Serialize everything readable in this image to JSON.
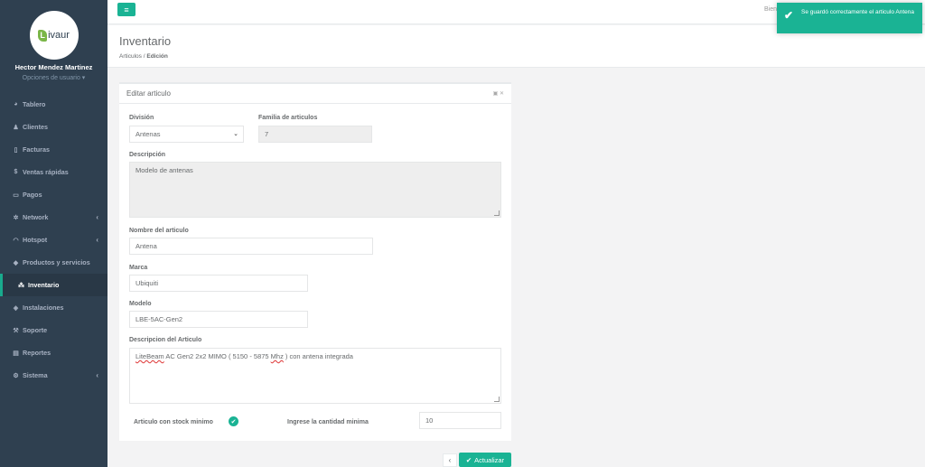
{
  "sidebar": {
    "logo_letter": "L",
    "logo_text": "ivaur",
    "user_name": "Hector Mendez Martinez",
    "user_options": "Opciones de usuario ▾",
    "items": [
      {
        "label": "Tablero",
        "icon": "dashboard-icon"
      },
      {
        "label": "Clientes",
        "icon": "users-icon"
      },
      {
        "label": "Facturas",
        "icon": "file-icon"
      },
      {
        "label": "Ventas rápidas",
        "icon": "dollar-icon"
      },
      {
        "label": "Pagos",
        "icon": "money-icon"
      },
      {
        "label": "Network",
        "icon": "network-icon"
      },
      {
        "label": "Hotspot",
        "icon": "wifi-icon"
      },
      {
        "label": "Productos y servicios",
        "icon": "tag-icon"
      },
      {
        "label": "Inventario",
        "icon": "cubes-icon"
      },
      {
        "label": "Instalaciones",
        "icon": "wrench-icon"
      },
      {
        "label": "Soporte",
        "icon": "support-icon"
      },
      {
        "label": "Reportes",
        "icon": "book-icon"
      },
      {
        "label": "Sistema",
        "icon": "cogs-icon"
      }
    ]
  },
  "topbar": {
    "welcome": "Bien"
  },
  "heading": {
    "title": "Inventario",
    "crumb_1": "Articulos",
    "crumb_sep": "/",
    "crumb_2": "Edición"
  },
  "panel": {
    "title": "Editar articulo",
    "division_label": "División",
    "division_value": "Antenas",
    "familia_label": "Familia de articulos",
    "familia_value": "7",
    "descripcion_label": "Descripción",
    "descripcion_value": "Modelo de antenas",
    "nombre_label": "Nombre del articulo",
    "nombre_value": "Antena",
    "marca_label": "Marca",
    "marca_value": "Ubiquiti",
    "modelo_label": "Modelo",
    "modelo_value": "LBE-5AC-Gen2",
    "desc_articulo_label": "Descripcion del Articulo",
    "desc_articulo_p1": "LiteBeam",
    "desc_articulo_p2": " AC Gen2 2x2 MIMO ( 5150 - 5875 ",
    "desc_articulo_p3": "Mhz",
    "desc_articulo_p4": " ) con antena integrada",
    "stock_label": "Articulo con stock minimo",
    "cantidad_label": "Ingrese la cantidad minima",
    "cantidad_value": "10"
  },
  "buttons": {
    "back": "‹",
    "save": "Actualizar"
  },
  "toast": {
    "message": "Se guardó correctamente el articulo Antena"
  },
  "colors": {
    "accent": "#1ab394",
    "sidebar": "#2f4050"
  }
}
